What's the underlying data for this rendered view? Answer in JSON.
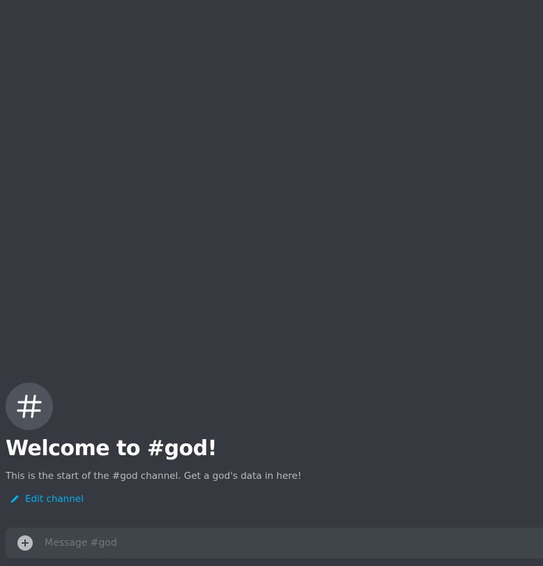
{
  "channel": {
    "icon": "hash-icon",
    "welcome_title": "Welcome to #god!",
    "description": "This is the start of the #god channel. Get a god's data in here!",
    "edit_label": "Edit channel"
  },
  "composer": {
    "attach_icon": "plus-circle-icon",
    "placeholder": "Message #god",
    "value": ""
  },
  "colors": {
    "background": "#36393f",
    "icon_circle": "#4f545c",
    "link": "#00b0f4",
    "input_bg": "#40444b"
  }
}
